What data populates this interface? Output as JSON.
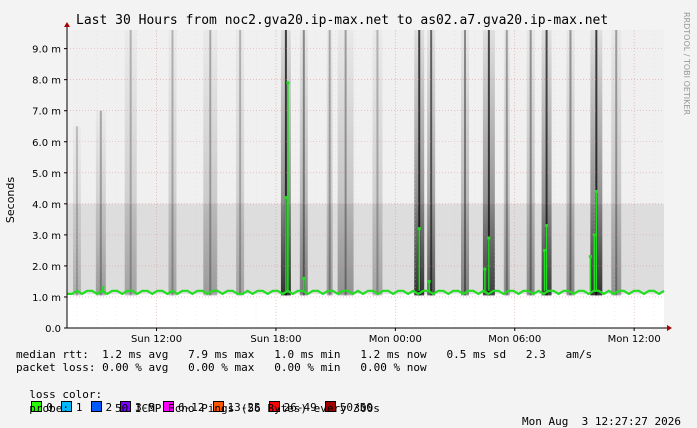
{
  "chart_data": {
    "type": "line",
    "title": "Last 30 Hours from noc2.gva20.ip-max.net to as02.a7.gva20.ip-max.net",
    "ylabel": "Seconds",
    "watermark": "RRDTOOL / TOBI OETIKER",
    "ylim": [
      0,
      9.6
    ],
    "y_ticks": [
      {
        "v": 0,
        "label": "0.0"
      },
      {
        "v": 1,
        "label": "1.0 m"
      },
      {
        "v": 2,
        "label": "2.0 m"
      },
      {
        "v": 3,
        "label": "3.0 m"
      },
      {
        "v": 4,
        "label": "4.0 m"
      },
      {
        "v": 5,
        "label": "5.0 m"
      },
      {
        "v": 6,
        "label": "6.0 m"
      },
      {
        "v": 7,
        "label": "7.0 m"
      },
      {
        "v": 8,
        "label": "8.0 m"
      },
      {
        "v": 9,
        "label": "9.0 m"
      }
    ],
    "xlim": [
      0,
      30
    ],
    "x_ticks": [
      {
        "h": 4.5,
        "label": "Sun 12:00"
      },
      {
        "h": 10.5,
        "label": "Sun 18:00"
      },
      {
        "h": 16.5,
        "label": "Mon 00:00"
      },
      {
        "h": 22.5,
        "label": "Mon 06:00"
      },
      {
        "h": 28.5,
        "label": "Mon 12:00"
      }
    ],
    "median_rtt_ms": [
      1.1,
      1.1,
      1.2,
      1.1,
      1.2,
      1.2,
      1.1,
      1.2,
      1.1,
      1.2,
      1.2,
      1.1,
      1.2,
      1.2,
      1.1,
      1.2,
      1.2,
      1.1,
      1.2,
      1.2,
      1.1,
      1.2,
      1.1,
      1.2,
      1.2,
      1.1,
      1.2,
      1.2,
      1.1,
      1.2,
      1.2,
      1.1,
      1.2,
      1.2,
      1.1,
      1.1,
      1.2,
      1.1,
      1.2,
      1.2,
      1.1,
      1.2,
      1.2,
      1.1,
      1.2,
      1.1,
      1.2,
      1.2,
      1.1,
      1.2,
      1.2,
      1.1,
      1.2,
      1.2,
      1.1,
      1.2,
      1.2,
      1.1,
      1.2,
      1.1,
      1.2,
      1.2,
      1.1,
      1.2,
      1.2,
      1.1,
      1.2,
      1.2,
      1.1,
      1.2,
      1.1,
      1.2,
      1.2,
      1.1,
      1.2,
      1.2,
      1.1,
      1.2,
      1.2,
      1.1,
      1.2,
      1.2,
      1.1,
      1.2,
      1.1,
      1.2,
      1.2,
      1.1,
      1.2,
      1.2,
      1.1,
      1.2,
      1.2,
      1.1,
      1.2,
      1.1,
      1.2,
      1.2,
      1.1,
      1.2,
      1.2,
      1.1,
      1.2,
      1.2,
      1.1,
      1.2,
      1.2,
      1.1,
      1.2,
      1.1,
      1.2,
      1.2,
      1.1,
      1.2,
      1.2,
      1.1,
      1.2,
      1.2,
      1.1,
      1.2
    ],
    "median_spikes": [
      {
        "h": 1.8,
        "v": 1.3
      },
      {
        "h": 11.0,
        "v": 4.2
      },
      {
        "h": 11.1,
        "v": 7.9
      },
      {
        "h": 11.9,
        "v": 1.6
      },
      {
        "h": 17.7,
        "v": 3.2
      },
      {
        "h": 18.2,
        "v": 1.5
      },
      {
        "h": 21.0,
        "v": 1.9
      },
      {
        "h": 21.2,
        "v": 2.9
      },
      {
        "h": 24.0,
        "v": 2.5
      },
      {
        "h": 24.1,
        "v": 3.3
      },
      {
        "h": 26.3,
        "v": 2.3
      },
      {
        "h": 26.5,
        "v": 3.0
      },
      {
        "h": 26.6,
        "v": 4.4
      }
    ],
    "smoke_bands": [
      {
        "h": 0.5,
        "w": 0.4,
        "top": 6.5,
        "darkness": 0.25
      },
      {
        "h": 1.7,
        "w": 0.5,
        "top": 7.0,
        "darkness": 0.35
      },
      {
        "h": 3.2,
        "w": 0.6,
        "top": 9.6,
        "darkness": 0.3
      },
      {
        "h": 5.3,
        "w": 0.4,
        "top": 9.6,
        "darkness": 0.3
      },
      {
        "h": 7.2,
        "w": 0.7,
        "top": 9.6,
        "darkness": 0.35
      },
      {
        "h": 8.7,
        "w": 0.4,
        "top": 9.6,
        "darkness": 0.3
      },
      {
        "h": 11.0,
        "w": 0.5,
        "top": 9.6,
        "darkness": 0.9
      },
      {
        "h": 11.9,
        "w": 0.4,
        "top": 9.6,
        "darkness": 0.5
      },
      {
        "h": 13.2,
        "w": 0.3,
        "top": 9.6,
        "darkness": 0.35
      },
      {
        "h": 14.0,
        "w": 0.8,
        "top": 9.6,
        "darkness": 0.4
      },
      {
        "h": 15.6,
        "w": 0.5,
        "top": 9.6,
        "darkness": 0.3
      },
      {
        "h": 17.7,
        "w": 0.5,
        "top": 9.6,
        "darkness": 0.9
      },
      {
        "h": 18.3,
        "w": 0.4,
        "top": 9.6,
        "darkness": 0.7
      },
      {
        "h": 20.0,
        "w": 0.4,
        "top": 9.6,
        "darkness": 0.5
      },
      {
        "h": 21.2,
        "w": 0.6,
        "top": 9.6,
        "darkness": 0.85
      },
      {
        "h": 22.1,
        "w": 0.3,
        "top": 9.6,
        "darkness": 0.4
      },
      {
        "h": 23.3,
        "w": 0.4,
        "top": 9.6,
        "darkness": 0.45
      },
      {
        "h": 24.1,
        "w": 0.5,
        "top": 9.6,
        "darkness": 0.85
      },
      {
        "h": 25.3,
        "w": 0.4,
        "top": 9.6,
        "darkness": 0.45
      },
      {
        "h": 26.6,
        "w": 0.6,
        "top": 9.6,
        "darkness": 0.9
      },
      {
        "h": 27.6,
        "w": 0.5,
        "top": 9.6,
        "darkness": 0.4
      }
    ],
    "grid": true,
    "colors": {
      "median_line": "#22dd22",
      "smoke": "#000000",
      "background": "#ffffff",
      "grid": "#ff0000"
    }
  },
  "stats": {
    "median_rtt": "median rtt:  1.2 ms avg   7.9 ms max   1.0 ms min   1.2 ms now   0.5 ms sd   2.3   am/s",
    "packet_loss": "packet loss: 0.00 % avg   0.00 % max   0.00 % min   0.00 % now",
    "loss_color_label": "loss color:",
    "loss_colors": [
      {
        "label": "0",
        "color": "#26ff00"
      },
      {
        "label": "1",
        "color": "#00b8ff"
      },
      {
        "label": "2",
        "color": "#0059ff"
      },
      {
        "label": "3-5",
        "color": "#7e00ff"
      },
      {
        "label": "6-12",
        "color": "#ff00ff"
      },
      {
        "label": "13-25",
        "color": "#ff5500"
      },
      {
        "label": "26-49",
        "color": "#ff0000"
      },
      {
        "label": "50/50",
        "color": "#a10000"
      }
    ],
    "probe_label": "probe:",
    "probe_desc": "50 ICMP Echo Pings (56 Bytes) every 300s",
    "timestamp": "Mon Aug  3 12:27:27 2026"
  }
}
